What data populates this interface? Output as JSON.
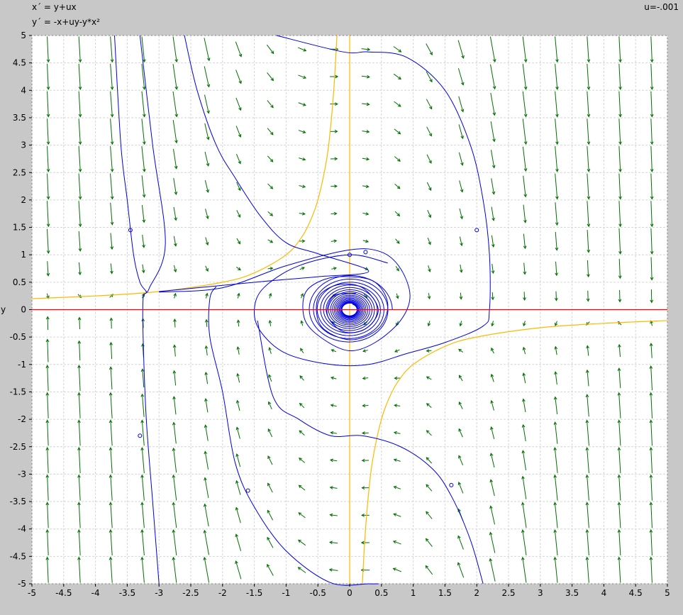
{
  "equations": {
    "x_eq": "x´ = y+ux",
    "y_eq": "y´ = -x+uy-y*x²"
  },
  "parameter": {
    "label": "u=-.001",
    "u": -0.001
  },
  "chart_data": {
    "type": "phase_portrait",
    "xlim": [
      -5,
      5
    ],
    "ylim": [
      -5,
      5
    ],
    "xticks": [
      "-5",
      "-4.5",
      "-4",
      "-3.5",
      "-3",
      "-2.5",
      "-2",
      "-1.5",
      "-1",
      "-0.5",
      "0",
      "0.5",
      "1",
      "1.5",
      "2",
      "2.5",
      "3",
      "3.5",
      "4",
      "4.5",
      "5"
    ],
    "yticks": [
      "5",
      "4.5",
      "4",
      "3.5",
      "3",
      "2.5",
      "2",
      "1.5",
      "1",
      "0.5",
      "0",
      "-0.5",
      "-1",
      "-1.5",
      "-2",
      "-2.5",
      "-3",
      "-3.5",
      "-4",
      "-4.5",
      "-5"
    ],
    "ylabel": "y",
    "grid": true,
    "colors": {
      "vector_field": "#007000",
      "trajectories": "#0000e0",
      "x_nullcline": "#ffb800",
      "y_axis_nullcline": "#ff0000",
      "grid": "#d6d6d6"
    },
    "vector_field": {
      "x": [
        -4.75,
        -4.25,
        -3.75,
        -3.25,
        -2.75,
        -2.25,
        -1.75,
        -1.25,
        -0.75,
        -0.25,
        0.25,
        0.75,
        1.25,
        1.75,
        2.25,
        2.75,
        3.25,
        3.75,
        4.25,
        4.75
      ],
      "y": [
        4.75,
        4.25,
        3.75,
        3.25,
        2.75,
        2.25,
        1.75,
        1.25,
        0.75,
        0.25,
        -0.25,
        -0.75,
        -1.25,
        -1.75,
        -2.25,
        -2.75,
        -3.25,
        -3.75,
        -4.25,
        -4.75
      ]
    },
    "nullclines": [
      {
        "name": "x-nullcline branch left",
        "points": [
          [
            -5,
            0.2
          ],
          [
            -4,
            0.25
          ],
          [
            -3,
            0.33
          ],
          [
            -2,
            0.5
          ],
          [
            -1.5,
            0.67
          ],
          [
            -1,
            1
          ],
          [
            -0.75,
            1.33
          ],
          [
            -0.6,
            1.67
          ],
          [
            -0.5,
            2
          ],
          [
            -0.4,
            2.5
          ],
          [
            -0.33,
            3
          ],
          [
            -0.25,
            4
          ],
          [
            -0.2,
            5
          ]
        ]
      },
      {
        "name": "x-nullcline branch right",
        "points": [
          [
            5,
            -0.2
          ],
          [
            4,
            -0.25
          ],
          [
            3,
            -0.33
          ],
          [
            2,
            -0.5
          ],
          [
            1.5,
            -0.67
          ],
          [
            1,
            -1
          ],
          [
            0.75,
            -1.33
          ],
          [
            0.6,
            -1.67
          ],
          [
            0.5,
            -2
          ],
          [
            0.4,
            -2.5
          ],
          [
            0.33,
            -3
          ],
          [
            0.25,
            -4
          ],
          [
            0.2,
            -5
          ]
        ]
      },
      {
        "name": "y-nullcline x=0",
        "points": [
          [
            0,
            -5
          ],
          [
            0,
            5
          ]
        ]
      }
    ],
    "trajectories": [
      {
        "name": "t1",
        "points": [
          [
            -3.7,
            5
          ],
          [
            -3.6,
            3
          ],
          [
            -3.5,
            2
          ],
          [
            -3.4,
            1
          ],
          [
            -3.3,
            0.5
          ],
          [
            -3.2,
            0.32
          ],
          [
            -3.25,
            0.2
          ],
          [
            -3.25,
            -0.5
          ],
          [
            -3.2,
            -2
          ],
          [
            -3.1,
            -3.5
          ],
          [
            -3.0,
            -5
          ]
        ]
      },
      {
        "name": "t2",
        "points": [
          [
            -2.6,
            5
          ],
          [
            -2.4,
            4
          ],
          [
            -2.1,
            3
          ],
          [
            -1.8,
            2.4
          ],
          [
            -1.4,
            1.7
          ],
          [
            -1.0,
            1.22
          ],
          [
            -0.5,
            1.02
          ],
          [
            0.3,
            0.7
          ],
          [
            -0.5,
            0.6
          ],
          [
            -1.3,
            0.52
          ],
          [
            -2.2,
            0.42
          ],
          [
            -3.0,
            0.33
          ]
        ]
      },
      {
        "name": "t3",
        "points": [
          [
            -3.0,
            0.32
          ],
          [
            -2.0,
            0.4
          ],
          [
            -1.0,
            0.8
          ],
          [
            0,
            1.09
          ],
          [
            0.5,
            1.05
          ],
          [
            0.8,
            0.75
          ],
          [
            0.95,
            0.25
          ],
          [
            0.8,
            -0.2
          ],
          [
            0.4,
            -0.6
          ],
          [
            0,
            -0.75
          ],
          [
            -0.4,
            -0.55
          ],
          [
            -0.7,
            -0.2
          ],
          [
            -0.7,
            0.3
          ],
          [
            -0.4,
            0.55
          ],
          [
            0,
            0.6
          ],
          [
            0.4,
            0.5
          ],
          [
            0.6,
            0.1
          ],
          [
            0.45,
            -0.35
          ],
          [
            0,
            -0.55
          ],
          [
            -0.45,
            -0.3
          ],
          [
            -0.5,
            0.2
          ],
          [
            -0.2,
            0.45
          ],
          [
            0.2,
            0.4
          ],
          [
            0.45,
            0.0
          ],
          [
            0.25,
            -0.35
          ],
          [
            -0.1,
            -0.4
          ],
          [
            -0.35,
            -0.1
          ],
          [
            -0.25,
            0.25
          ],
          [
            0.1,
            0.3
          ]
        ]
      },
      {
        "name": "t4",
        "points": [
          [
            -3.3,
            5
          ],
          [
            -3.1,
            3
          ],
          [
            -2.9,
            1.2
          ],
          [
            -3.15,
            0.4
          ],
          [
            -3.2,
            0.33
          ]
        ]
      },
      {
        "name": "t5",
        "points": [
          [
            -1.15,
            5
          ],
          [
            -0.1,
            4.7
          ],
          [
            0.3,
            4.7
          ],
          [
            0.9,
            4.6
          ],
          [
            1.5,
            4
          ],
          [
            1.9,
            3
          ],
          [
            2.1,
            2
          ],
          [
            2.2,
            1
          ],
          [
            2.2,
            0
          ],
          [
            2.1,
            -0.3
          ],
          [
            1.5,
            -0.6
          ],
          [
            0.9,
            -0.8
          ],
          [
            0.3,
            -1.0
          ],
          [
            -0.3,
            -1.0
          ],
          [
            -1.0,
            -0.8
          ],
          [
            -1.4,
            -0.4
          ],
          [
            -1.5,
            0
          ],
          [
            -1.35,
            0.4
          ],
          [
            -0.8,
            0.8
          ],
          [
            0,
            1.0
          ],
          [
            0.6,
            0.85
          ]
        ]
      },
      {
        "name": "t6",
        "points": [
          [
            -2.1,
            0.42
          ],
          [
            -2.2,
            0.2
          ],
          [
            -2.2,
            -0.5
          ],
          [
            -2.0,
            -1.5
          ],
          [
            -1.8,
            -2.8
          ],
          [
            -1.5,
            -3.6
          ],
          [
            -1.0,
            -4.4
          ],
          [
            -0.3,
            -4.98
          ],
          [
            0.3,
            -5.0
          ],
          [
            0.45,
            -5.0
          ]
        ]
      },
      {
        "name": "t7",
        "points": [
          [
            -1.45,
            -0.2
          ],
          [
            -1.2,
            -1.6
          ],
          [
            -0.8,
            -2.0
          ],
          [
            -0.3,
            -2.3
          ],
          [
            0.2,
            -2.3
          ],
          [
            0.8,
            -2.5
          ],
          [
            1.3,
            -2.9
          ],
          [
            1.6,
            -3.4
          ],
          [
            1.9,
            -4.2
          ],
          [
            2.1,
            -5
          ]
        ]
      }
    ]
  }
}
